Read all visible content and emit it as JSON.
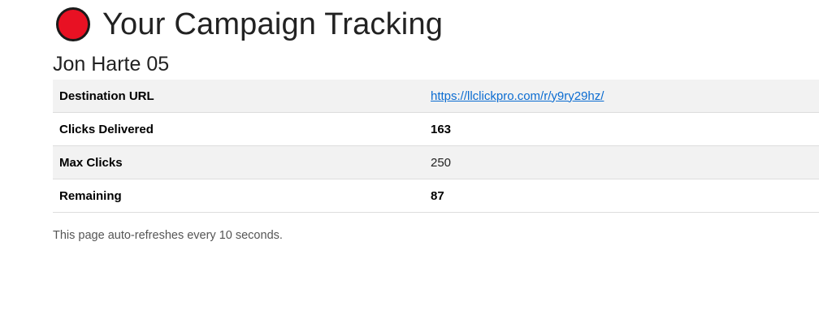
{
  "header": {
    "status_color": "#e81123",
    "title": "Your Campaign Tracking",
    "campaign_name": "Jon Harte 05"
  },
  "stats": {
    "destination_url_label": "Destination URL",
    "destination_url_value": "https://llclickpro.com/r/y9ry29hz/",
    "clicks_delivered_label": "Clicks Delivered",
    "clicks_delivered_value": "163",
    "max_clicks_label": "Max Clicks",
    "max_clicks_value": "250",
    "remaining_label": "Remaining",
    "remaining_value": "87"
  },
  "footer": {
    "refresh_note": "This page auto-refreshes every 10 seconds."
  }
}
